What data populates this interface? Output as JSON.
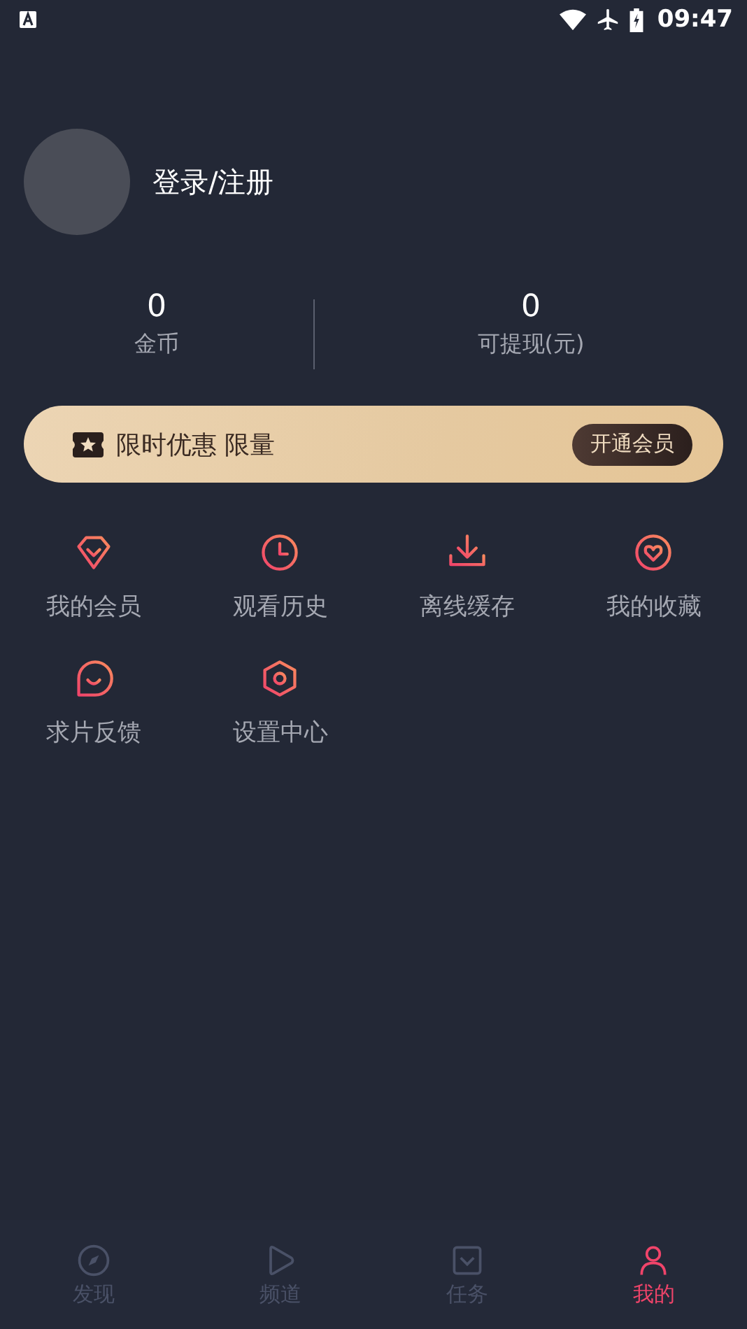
{
  "status_bar": {
    "time": "09:47"
  },
  "profile": {
    "login_label": "登录/注册"
  },
  "stats": [
    {
      "value": "0",
      "label": "金币"
    },
    {
      "value": "0",
      "label": "可提现(元)"
    }
  ],
  "promo": {
    "text": "限时优惠 限量",
    "button": "开通会员"
  },
  "menu": [
    {
      "label": "我的会员"
    },
    {
      "label": "观看历史"
    },
    {
      "label": "离线缓存"
    },
    {
      "label": "我的收藏"
    },
    {
      "label": "求片反馈"
    },
    {
      "label": "设置中心"
    }
  ],
  "bottom_nav": [
    {
      "label": "发现",
      "selected": false
    },
    {
      "label": "频道",
      "selected": false
    },
    {
      "label": "任务",
      "selected": false
    },
    {
      "label": "我的",
      "selected": true
    }
  ]
}
